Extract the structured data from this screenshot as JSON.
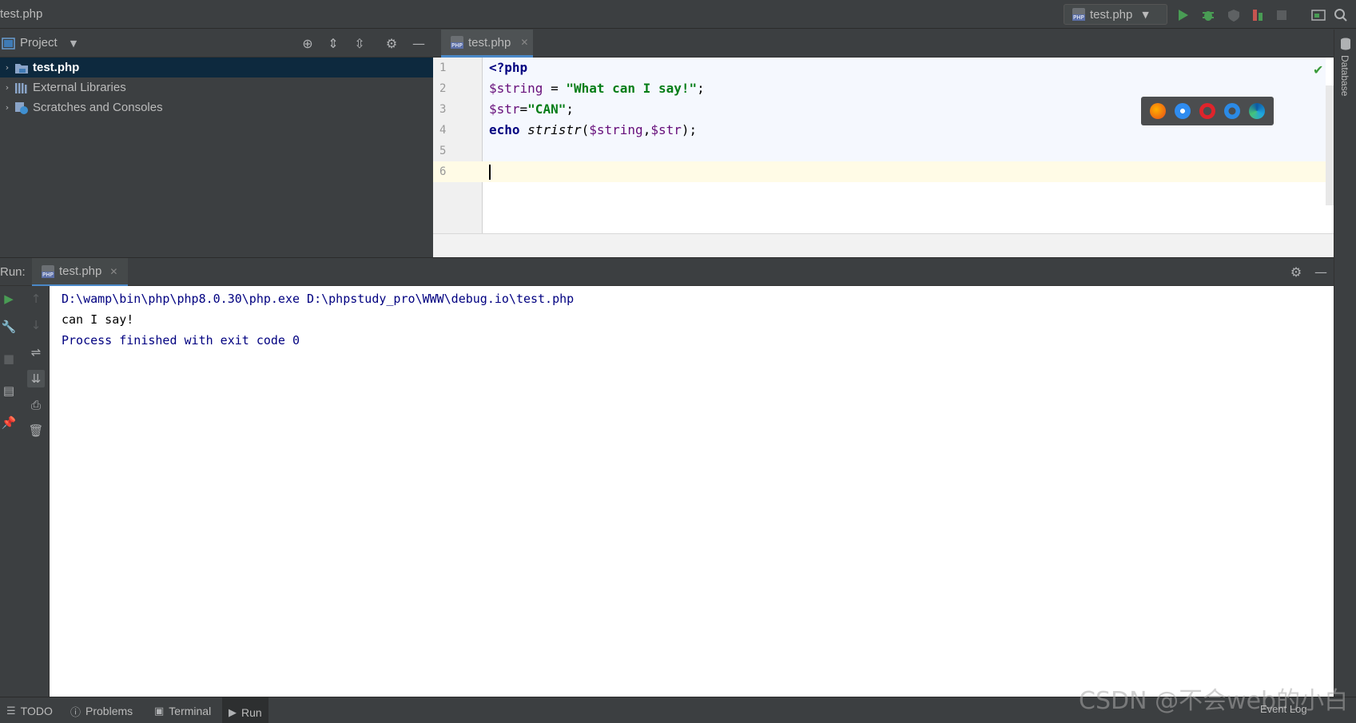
{
  "window": {
    "title": "test.php"
  },
  "toolbar": {
    "run_config": "test.php"
  },
  "project": {
    "header_label": "Project",
    "items": [
      {
        "label": "test.php",
        "selected": true
      },
      {
        "label": "External Libraries",
        "selected": false
      },
      {
        "label": "Scratches and Consoles",
        "selected": false
      }
    ]
  },
  "editor": {
    "tab_label": "test.php",
    "line_numbers": [
      "1",
      "2",
      "3",
      "4",
      "5",
      "6"
    ],
    "lines": {
      "l1_kw": "<?php",
      "l2_var": "$string",
      "l2_op": " = ",
      "l2_str": "\"What can I say!\"",
      "l2_end": ";",
      "l3_var": "$str",
      "l3_op": "=",
      "l3_str": "\"CAN\"",
      "l3_end": ";",
      "l4_kw": "echo",
      "l4_fn": "stristr",
      "l4_open": "(",
      "l4_var1": "$string",
      "l4_comma": ",",
      "l4_var2": "$str",
      "l4_close": ");"
    },
    "browsers": [
      "firefox",
      "safari",
      "opera",
      "internet-explorer",
      "edge"
    ]
  },
  "right_strip": {
    "label": "Database"
  },
  "run": {
    "label": "Run:",
    "tab_label": "test.php",
    "console": [
      "D:\\wamp\\bin\\php\\php8.0.30\\php.exe D:\\phpstudy_pro\\WWW\\debug.io\\test.php",
      "can I say!",
      "Process finished with exit code 0"
    ]
  },
  "statusbar": {
    "todo": "TODO",
    "problems": "Problems",
    "terminal": "Terminal",
    "run": "Run",
    "event_log": "Event Log"
  },
  "watermark": "CSDN @不会web的小白",
  "colors": {
    "accent": "#4a88c7",
    "keyword": "#000080",
    "string": "#067d17",
    "run_green": "#3a9b3a"
  }
}
